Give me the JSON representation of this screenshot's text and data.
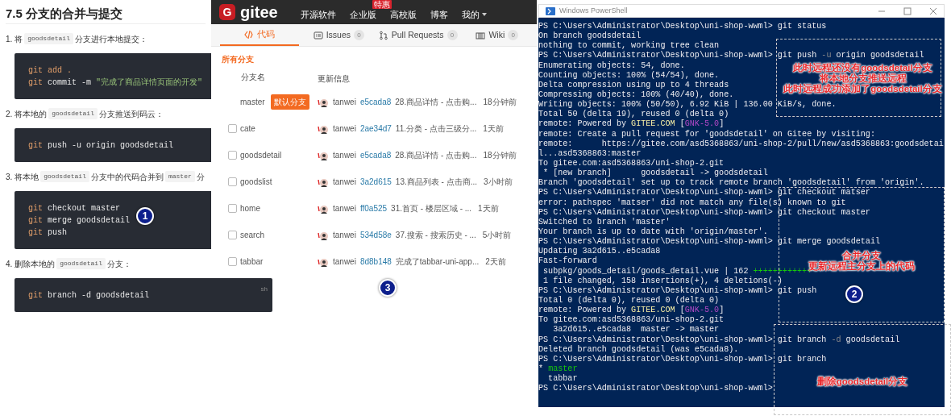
{
  "doc": {
    "title": "7.5 分支的合并与提交",
    "badge": "1",
    "steps": [
      {
        "parts": [
          {
            "text": "1. 将",
            "kind": "text"
          },
          {
            "text": "goodsdetail",
            "kind": "code"
          },
          {
            "text": "分支进行本地提交：",
            "kind": "text"
          }
        ],
        "code": {
          "lines": [
            [
              {
                "text": "git add .",
                "kind": "keyword"
              }
            ],
            [
              {
                "text": "git",
                "kind": "keyword"
              },
              {
                "text": " commit -m ",
                "kind": "plain"
              },
              {
                "text": "\"完成了商品详情页面的开发\"",
                "kind": "string"
              }
            ]
          ]
        }
      },
      {
        "parts": [
          {
            "text": "2. 将本地的",
            "kind": "text"
          },
          {
            "text": "goodsdetail",
            "kind": "code"
          },
          {
            "text": "分支推送到码云：",
            "kind": "text"
          }
        ],
        "code": {
          "lines": [
            [
              {
                "text": "git",
                "kind": "keyword"
              },
              {
                "text": " push -u origin goodsdetail",
                "kind": "plain"
              }
            ]
          ]
        }
      },
      {
        "parts": [
          {
            "text": "3. 将本地",
            "kind": "text"
          },
          {
            "text": "goodsdetail",
            "kind": "code"
          },
          {
            "text": "分支中的代码合并到",
            "kind": "text"
          },
          {
            "text": "master",
            "kind": "code"
          },
          {
            "text": "分",
            "kind": "text"
          }
        ],
        "code": {
          "lines": [
            [
              {
                "text": "git",
                "kind": "keyword"
              },
              {
                "text": " checkout master",
                "kind": "plain"
              }
            ],
            [
              {
                "text": "git",
                "kind": "keyword"
              },
              {
                "text": " merge goodsdetail",
                "kind": "plain"
              }
            ],
            [
              {
                "text": "git",
                "kind": "keyword"
              },
              {
                "text": " push",
                "kind": "plain"
              }
            ]
          ]
        }
      },
      {
        "parts": [
          {
            "text": "4. 删除本地的",
            "kind": "text"
          },
          {
            "text": "goodsdetail",
            "kind": "code"
          },
          {
            "text": "分支：",
            "kind": "text"
          }
        ],
        "code": {
          "lang": "sh",
          "lines": [
            [
              {
                "text": "git",
                "kind": "keyword"
              },
              {
                "text": " branch -d goodsdetail",
                "kind": "plain"
              }
            ]
          ]
        }
      }
    ]
  },
  "gitee": {
    "logo": {
      "mark": "G",
      "name": "gitee"
    },
    "badge": "3",
    "nav": [
      {
        "label": "开源软件"
      },
      {
        "label": "企业版",
        "tag": "特惠"
      },
      {
        "label": "高校版"
      },
      {
        "label": "博客"
      },
      {
        "label": "我的",
        "dropdown": true
      }
    ],
    "tabs": [
      {
        "label": "代码",
        "selected": true
      },
      {
        "label": "Issues",
        "count": "0",
        "selected": false
      },
      {
        "label": "Pull Requests",
        "count": "0",
        "selected": false
      },
      {
        "label": "Wiki",
        "count": "0",
        "selected": false
      }
    ],
    "section": "所有分支",
    "columns": [
      "分支名",
      "更新信息"
    ],
    "rows": [
      {
        "name": "master",
        "kind": "default",
        "tag": "默认分支",
        "author": "tanwei",
        "hash": "e5cada8",
        "message": "28.商品详情 - 点击购...",
        "time": "18分钟前"
      },
      {
        "name": "cate",
        "kind": "branch",
        "checked": false,
        "author": "tanwei",
        "hash": "2ae34d7",
        "message": "11.分类 - 点击三级分...",
        "time": "1天前"
      },
      {
        "name": "goodsdetail",
        "kind": "branch",
        "checked": false,
        "author": "tanwei",
        "hash": "e5cada8",
        "message": "28.商品详情 - 点击购...",
        "time": "18分钟前"
      },
      {
        "name": "goodslist",
        "kind": "branch",
        "checked": false,
        "author": "tanwei",
        "hash": "3a2d615",
        "message": "13.商品列表 - 点击商...",
        "time": "3小时前"
      },
      {
        "name": "home",
        "kind": "branch",
        "checked": false,
        "author": "tanwei",
        "hash": "ff0a525",
        "message": "31.首页 - 楼层区域 - ...",
        "time": "1天前"
      },
      {
        "name": "search",
        "kind": "branch",
        "checked": false,
        "author": "tanwei",
        "hash": "534d58e",
        "message": "37.搜索 - 搜索历史 - ...",
        "time": "5小时前"
      },
      {
        "name": "tabbar",
        "kind": "branch",
        "checked": false,
        "author": "tanwei",
        "hash": "8d8b148",
        "message": "完成了tabbar-uni-app...",
        "time": "2天前"
      }
    ]
  },
  "terminal": {
    "title": "Windows PowerShell",
    "badge": "2",
    "lines": [
      [
        {
          "text": "PS C:\\Users\\Administrator\\Desktop\\uni-shop-wwml> git status",
          "kind": "plain"
        }
      ],
      [
        {
          "text": "On branch goodsdetail",
          "kind": "plain"
        }
      ],
      [
        {
          "text": "nothing to commit, working tree clean",
          "kind": "plain"
        }
      ],
      [
        {
          "text": "PS C:\\Users\\Administrator\\Desktop\\uni-shop-wwml> git push ",
          "kind": "plain"
        },
        {
          "text": "-u",
          "kind": "flag"
        },
        {
          "text": " origin goodsdetail",
          "kind": "plain"
        }
      ],
      [
        {
          "text": "Enumerating objects: 54, done.",
          "kind": "plain"
        }
      ],
      [
        {
          "text": "Counting objects: 100% (54/54), done.",
          "kind": "plain"
        }
      ],
      [
        {
          "text": "Delta compression using up to 4 threads",
          "kind": "plain"
        }
      ],
      [
        {
          "text": "Compressing objects: 100% (40/40), done.",
          "kind": "plain"
        }
      ],
      [
        {
          "text": "Writing objects: 100% (50/50), 6.92 KiB | 136.00 KiB/s, done.",
          "kind": "plain"
        }
      ],
      [
        {
          "text": "Total 50 (delta 19), reused 0 (delta 0)",
          "kind": "plain"
        }
      ],
      [
        {
          "text": "remote: Powered by ",
          "kind": "plain"
        },
        {
          "text": "GITEE.COM",
          "kind": "highlight"
        },
        {
          "text": " [",
          "kind": "plain"
        },
        {
          "text": "GNK-5.0",
          "kind": "tag"
        },
        {
          "text": "]",
          "kind": "plain"
        }
      ],
      [
        {
          "text": "remote: Create a pull request for 'goodsdetail' on Gitee by visiting:",
          "kind": "plain"
        }
      ],
      [
        {
          "text": "remote:      https://gitee.com/asd5368863/uni-shop-2/pull/new/asd5368863:goodsdetai",
          "kind": "plain"
        }
      ],
      [
        {
          "text": "l...asd5368863:master",
          "kind": "plain"
        }
      ],
      [
        {
          "text": "To gitee.com:asd5368863/uni-shop-2.git",
          "kind": "plain"
        }
      ],
      [
        {
          "text": " * [new branch]      goodsdetail -> goodsdetail",
          "kind": "plain"
        }
      ],
      [
        {
          "text": "Branch 'goodsdetail' set up to track remote branch 'goodsdetail' from 'origin'.",
          "kind": "plain"
        }
      ],
      [
        {
          "text": "PS C:\\Users\\Administrator\\Desktop\\uni-shop-wwml> git checkout matser",
          "kind": "plain"
        }
      ],
      [
        {
          "text": "error: pathspec 'matser' did not match any file(s) known to git",
          "kind": "plain"
        }
      ],
      [
        {
          "text": "PS C:\\Users\\Administrator\\Desktop\\uni-shop-wwml> git checkout master",
          "kind": "plain"
        }
      ],
      [
        {
          "text": "Switched to branch 'master'",
          "kind": "plain"
        }
      ],
      [
        {
          "text": "Your branch is up to date with 'origin/master'.",
          "kind": "plain"
        }
      ],
      [
        {
          "text": "PS C:\\Users\\Administrator\\Desktop\\uni-shop-wwml> git merge goodsdetail",
          "kind": "plain"
        }
      ],
      [
        {
          "text": "Updating 3a2d615..e5cada8",
          "kind": "plain"
        }
      ],
      [
        {
          "text": "Fast-forward",
          "kind": "plain"
        }
      ],
      [
        {
          "text": " subpkg/goods_detail/goods_detail.vue | 162 ",
          "kind": "plain"
        },
        {
          "text": "++++++++++++",
          "kind": "current"
        }
      ],
      [
        {
          "text": " 1 file changed, 158 insertions(+), 4 deletions(-)",
          "kind": "plain"
        }
      ],
      [
        {
          "text": "PS C:\\Users\\Administrator\\Desktop\\uni-shop-wwml> git push",
          "kind": "plain"
        }
      ],
      [
        {
          "text": "Total 0 (delta 0), reused 0 (delta 0)",
          "kind": "plain"
        }
      ],
      [
        {
          "text": "remote: Powered by ",
          "kind": "plain"
        },
        {
          "text": "GITEE.COM",
          "kind": "highlight"
        },
        {
          "text": " [",
          "kind": "plain"
        },
        {
          "text": "GNK-5.0",
          "kind": "tag"
        },
        {
          "text": "]",
          "kind": "plain"
        }
      ],
      [
        {
          "text": "To gitee.com:asd5368863/uni-shop-2.git",
          "kind": "plain"
        }
      ],
      [
        {
          "text": "   3a2d615..e5cada8  master -> master",
          "kind": "plain"
        }
      ],
      [
        {
          "text": "PS C:\\Users\\Administrator\\Desktop\\uni-shop-wwml> git branch ",
          "kind": "plain"
        },
        {
          "text": "-d",
          "kind": "flag"
        },
        {
          "text": " goodsdetail",
          "kind": "plain"
        }
      ],
      [
        {
          "text": "Deleted branch goodsdetail (was e5cada8).",
          "kind": "plain"
        }
      ],
      [
        {
          "text": "PS C:\\Users\\Administrator\\Desktop\\uni-shop-wwml> git branch",
          "kind": "plain"
        }
      ],
      [
        {
          "text": "* ",
          "kind": "plain"
        },
        {
          "text": "master",
          "kind": "current"
        }
      ],
      [
        {
          "text": "  tabbar",
          "kind": "plain"
        }
      ],
      [
        {
          "text": "PS C:\\Users\\Administrator\\Desktop\\uni-shop-wwml>",
          "kind": "plain"
        }
      ]
    ],
    "notes": [
      {
        "lines": [
          "此时远程还没有goodsdetail分支",
          "将本地分支推送远程",
          "此时远程成功添加了goodsdetail分支"
        ]
      },
      {
        "lines": [
          "合并分支",
          "更新远程主分支上的代码"
        ]
      },
      {
        "lines": [
          "删除goodsdetail分支"
        ]
      }
    ]
  }
}
